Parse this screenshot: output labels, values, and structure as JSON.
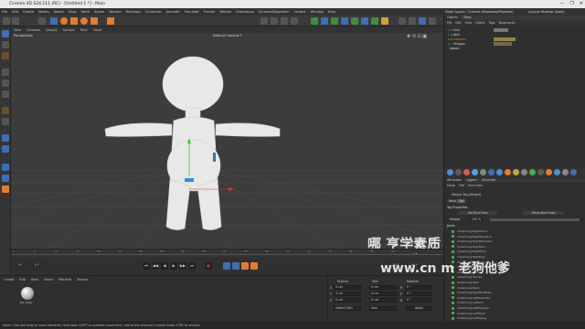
{
  "window": {
    "title": "Cinema 4D S24.111 (RC) - [Untitled 1 *] - Main",
    "controls": [
      "—",
      "❐",
      "✕"
    ]
  },
  "menubar": {
    "items": [
      "File",
      "Edit",
      "Create",
      "Modes",
      "Select",
      "Tools",
      "Mesh",
      "Spline",
      "Volume",
      "MoGraph",
      "Character",
      "Animate",
      "Simulate",
      "Tracker",
      "Render",
      "Extensions",
      "Cinema4Dlgorithm",
      "Octane",
      "Window",
      "Help"
    ],
    "node_space_label": "Node Space:",
    "node_space_value": "Current (Standard/Physical)",
    "layout_label": "Layout:",
    "layout_value": "Startup (User)"
  },
  "viewport": {
    "menu": [
      "View",
      "Cameras",
      "Display",
      "Options",
      "Filter",
      "Panel"
    ],
    "view_name": "Perspective",
    "camera_name": "Default Camera:*",
    "grid_spacing": "Grid Spacing : 100 cm"
  },
  "timeline": {
    "ticks": [
      "0",
      "5",
      "10",
      "15",
      "20",
      "25",
      "30",
      "35",
      "40",
      "45",
      "50",
      "55",
      "60",
      "65",
      "70",
      "75",
      "80",
      "85",
      "90"
    ],
    "end_label": "0 F"
  },
  "transport": {
    "start_frame": "0 F",
    "current_frame": "0 F",
    "end_frame": "90 F",
    "end_frame2": "90 F",
    "buttons": [
      "⏮",
      "◀◀",
      "◀",
      "▶",
      "▶▶",
      "⏭",
      "●"
    ]
  },
  "material_manager": {
    "menu": [
      "Create",
      "Edit",
      "View",
      "Select",
      "Material",
      "Texture"
    ],
    "material_name": "Ice Cube"
  },
  "coordinates": {
    "headers": [
      "Position",
      "Size",
      "Rotation"
    ],
    "rows": [
      {
        "axis": "X",
        "pos": "0 cm",
        "size": "0 cm",
        "rot_label": "H",
        "rot": "0 °"
      },
      {
        "axis": "Y",
        "pos": "0 cm",
        "size": "0 cm",
        "rot_label": "P",
        "rot": "0 °"
      },
      {
        "axis": "Z",
        "pos": "0 cm",
        "size": "0 cm",
        "rot_label": "B",
        "rot": "0 °"
      }
    ],
    "mode_select": "Object (Rel)",
    "size_select": "Size",
    "apply_label": "Apply"
  },
  "object_manager": {
    "tabs": [
      "Objects",
      "Takes"
    ],
    "menu": [
      "File",
      "Edit",
      "View",
      "Object",
      "Tags",
      "Bookmarks"
    ],
    "objects": [
      "Null",
      "Joint",
      "nulseam",
      "Polygon",
      "lobsee"
    ]
  },
  "attributes": {
    "tabs": [
      "Attributes",
      "Layers",
      "Structure"
    ],
    "menu": [
      "Mode",
      "Edit",
      "User Data"
    ],
    "title": "Weight Tag [Weight]",
    "subtabs": [
      "Basic",
      "Tag"
    ],
    "section": "Tag Properties",
    "row1_left": "Set Bind Pose",
    "row1_right": "Reset Bind Pose",
    "weight_label": "Weight",
    "weight_value": "100 %",
    "joints_label": "Joints",
    "joints": [
      "mixamorig:RightHand",
      "mixamorig:RightForeArm",
      "mixamorig:RightShoulder",
      "mixamorig:RightArm",
      "mixamorig:RightFoot",
      "mixamorig:RightLeg",
      "mixamorig:RightUpLeg",
      "mixamorig:Spine2",
      "mixamorig:Spine",
      "mixamorig:Spine1",
      "mixamorig:Hips",
      "mixamorig:Neck",
      "mixamorig:RightToeBase",
      "mixamorig:LeftShoulder",
      "mixamorig:LeftArm",
      "mixamorig:LeftForeArm",
      "mixamorig:LeftHand",
      "mixamorig:LeftUpLeg"
    ]
  },
  "statusbar": {
    "text": "Move: Click and drag to move elements. Hold down SHIFT to quantize movement / add to the selection in point mode, CTRL to remove."
  },
  "watermark": {
    "line1": "哪   亨学素质课程",
    "line2": "www.cn   m 老狗他爹"
  },
  "colors": {
    "accent": "#e57c2b",
    "blue": "#3d6fb6",
    "bg": "#2b2b2b"
  }
}
